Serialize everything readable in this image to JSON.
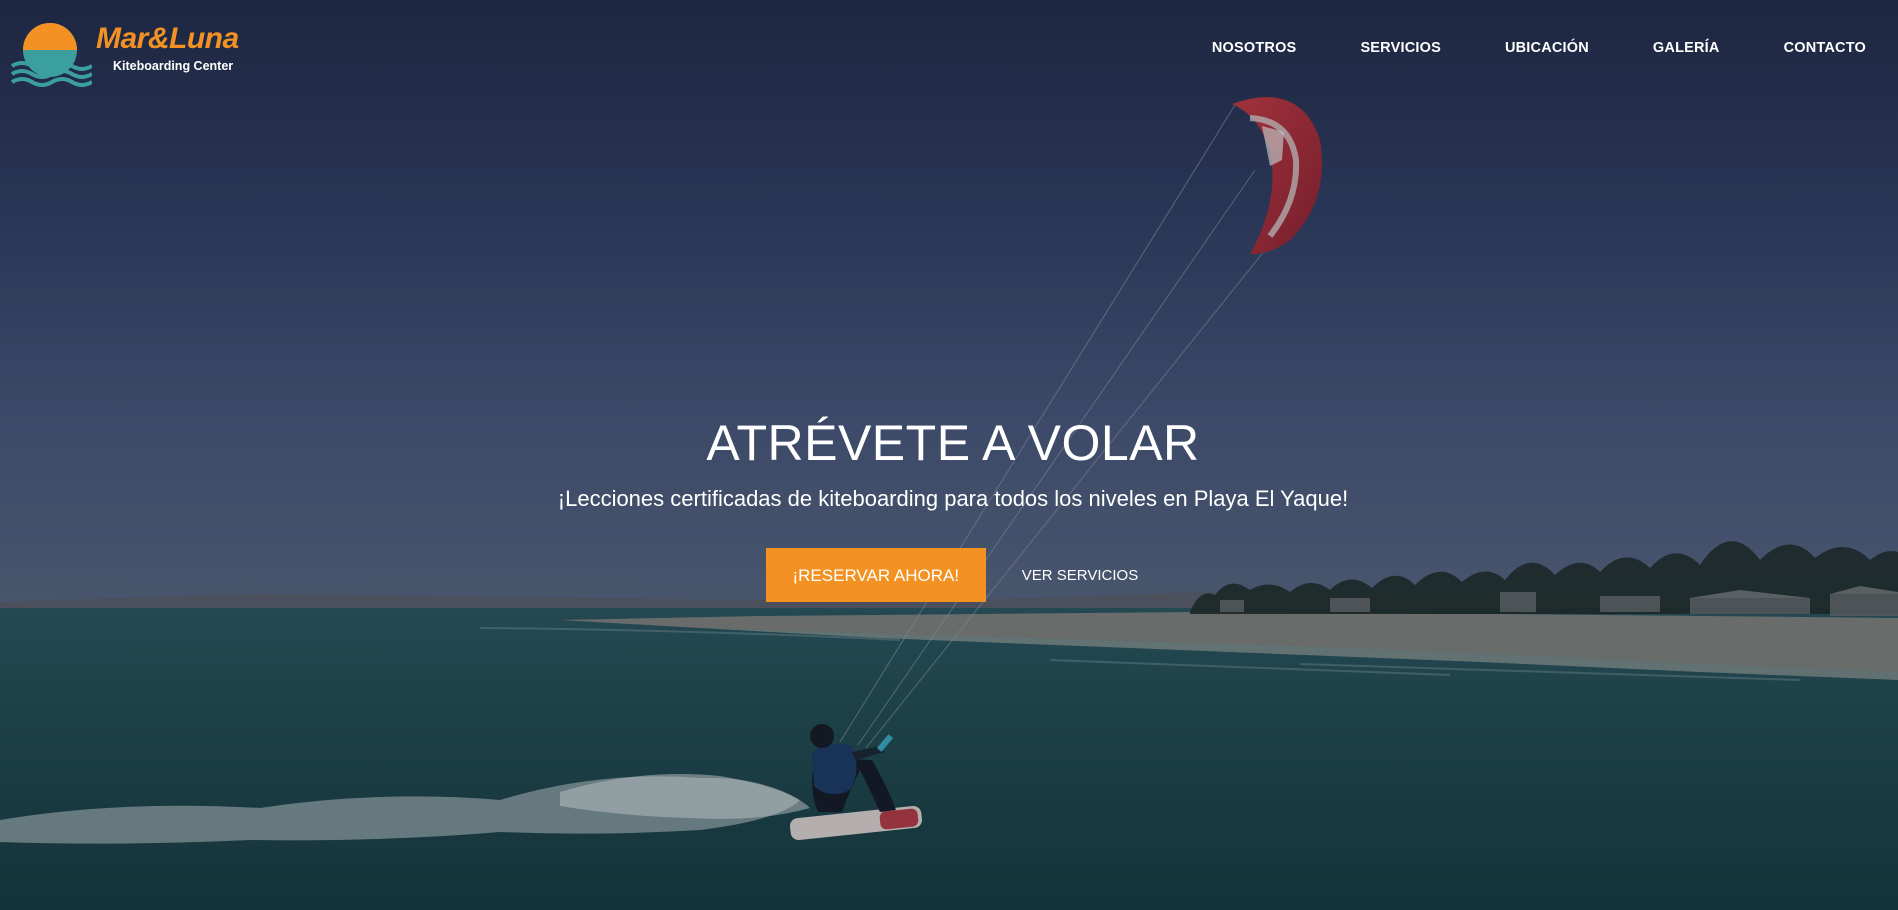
{
  "brand": {
    "name": "Mar&Luna",
    "tagline": "Kiteboarding Center",
    "logo_icon": "sun-over-waves-logo",
    "colors": {
      "accent": "#f39223",
      "logo_teal": "#3b9fa0",
      "text": "#ffffff"
    }
  },
  "nav": {
    "items": [
      {
        "label": "NOSOTROS"
      },
      {
        "label": "SERVICIOS"
      },
      {
        "label": "UBICACIÓN"
      },
      {
        "label": "GALERÍA"
      },
      {
        "label": "CONTACTO"
      }
    ]
  },
  "hero": {
    "title": "ATRÉVETE A VOLAR",
    "subtitle": "¡Lecciones certificadas de kiteboarding para todos los niveles en Playa El Yaque!",
    "primary_button": "¡RESERVAR AHORA!",
    "secondary_button": "VER SERVICIOS",
    "background_image": "kitesurfer-on-sea-with-red-kite-and-beach",
    "colors": {
      "sky_top": "#243052",
      "sky_horizon": "#4a5a7c",
      "sea": "#1f4a4e",
      "kite": "#b0303a"
    }
  }
}
